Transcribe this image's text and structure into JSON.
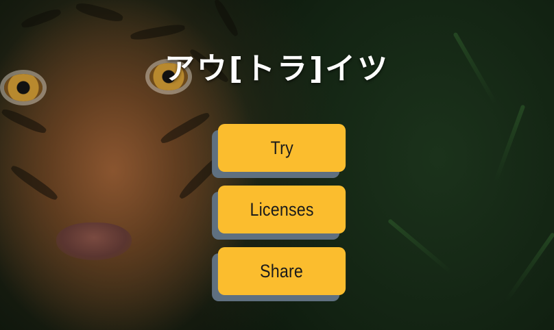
{
  "title": "アウ[トラ]イツ",
  "menu": {
    "buttons": [
      {
        "label": "Try"
      },
      {
        "label": "Licenses"
      },
      {
        "label": "Share"
      }
    ]
  },
  "colors": {
    "button_fill": "#fbbd2e",
    "button_shadow": "#5f7080",
    "title_text": "#ffffff"
  }
}
